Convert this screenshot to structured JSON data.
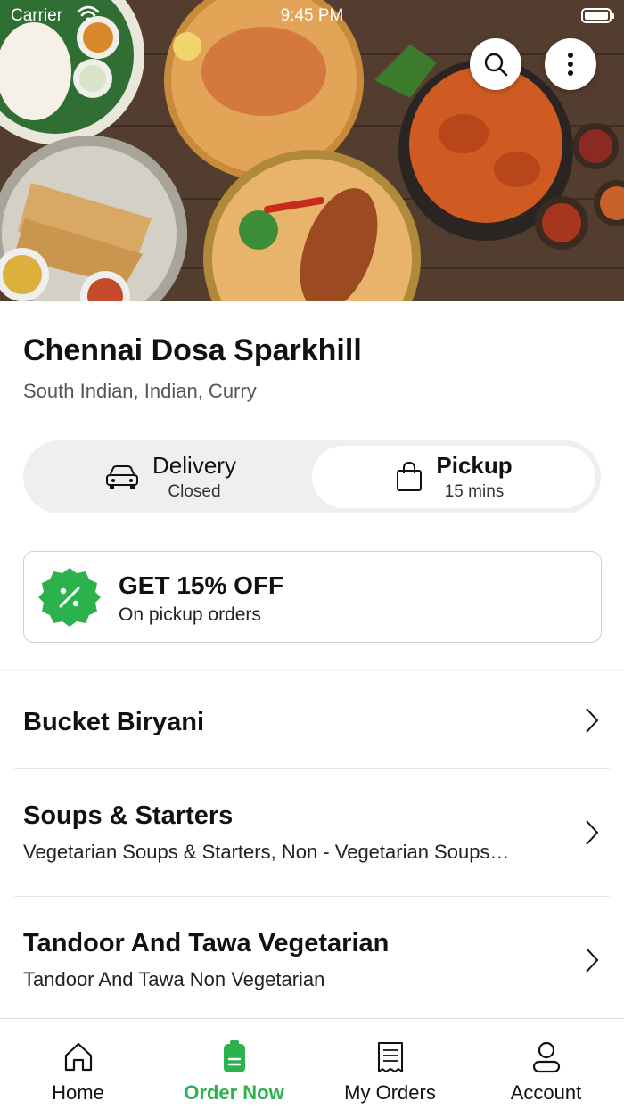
{
  "status_bar": {
    "carrier": "Carrier",
    "time": "9:45 PM"
  },
  "restaurant": {
    "name": "Chennai Dosa Sparkhill",
    "cuisines": "South Indian, Indian, Curry"
  },
  "order_mode": {
    "delivery": {
      "label": "Delivery",
      "status": "Closed",
      "icon": "car-icon"
    },
    "pickup": {
      "label": "Pickup",
      "status": "15 mins",
      "icon": "shopping-bag-icon",
      "selected": true
    }
  },
  "offer": {
    "title": "GET 15% OFF",
    "subtitle": "On pickup orders",
    "badge_color": "#2bb24c"
  },
  "menu": [
    {
      "name": "Bucket Biryani",
      "subtitle": ""
    },
    {
      "name": "Soups & Starters",
      "subtitle": "Vegetarian Soups & Starters, Non - Vegetarian Soups…"
    },
    {
      "name": "Tandoor And Tawa Vegetarian",
      "subtitle": "Tandoor And Tawa Non Vegetarian"
    }
  ],
  "tabs": [
    {
      "label": "Home",
      "icon": "home-icon"
    },
    {
      "label": "Order Now",
      "icon": "order-icon",
      "active": true
    },
    {
      "label": "My Orders",
      "icon": "receipt-icon"
    },
    {
      "label": "Account",
      "icon": "user-icon"
    }
  ],
  "colors": {
    "accent": "#2bb24c",
    "text": "#111111",
    "muted": "#555555"
  }
}
